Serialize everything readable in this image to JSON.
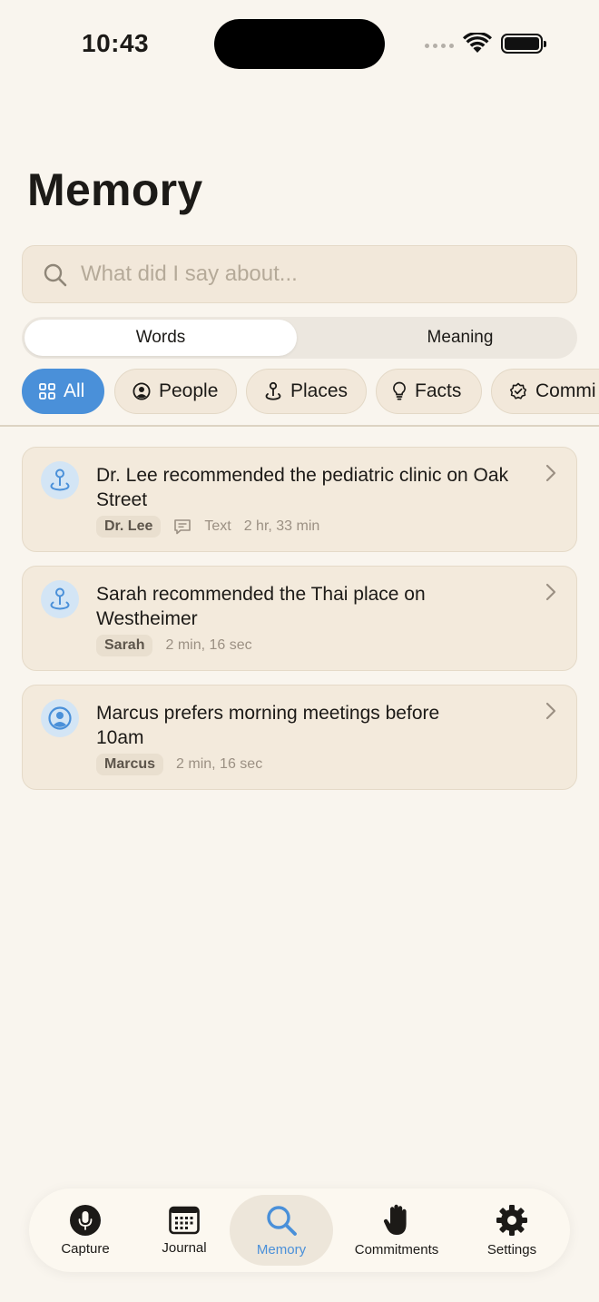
{
  "status_bar": {
    "time": "10:43"
  },
  "header": {
    "title": "Memory"
  },
  "search": {
    "placeholder": "What did I say about..."
  },
  "segmented": {
    "options": [
      "Words",
      "Meaning"
    ],
    "selected": "Words"
  },
  "filters": {
    "items": [
      {
        "label": "All",
        "icon": "grid-icon",
        "active": true
      },
      {
        "label": "People",
        "icon": "person-circle-icon",
        "active": false
      },
      {
        "label": "Places",
        "icon": "location-pin-icon",
        "active": false
      },
      {
        "label": "Facts",
        "icon": "lightbulb-icon",
        "active": false
      },
      {
        "label": "Commi",
        "icon": "checkmark-seal-icon",
        "active": false
      }
    ]
  },
  "memories": [
    {
      "title": "Dr. Lee recommended the pediatric clinic on Oak Street",
      "person": "Dr. Lee",
      "source": "Text",
      "time": "2 hr, 33 min",
      "icon": "location-pin-icon"
    },
    {
      "title": "Sarah recommended the Thai place on Westheimer",
      "person": "Sarah",
      "time": "2 min, 16 sec",
      "icon": "location-pin-icon"
    },
    {
      "title": "Marcus prefers morning meetings before 10am",
      "person": "Marcus",
      "time": "2 min, 16 sec",
      "icon": "person-circle-icon"
    }
  ],
  "tabbar": {
    "tabs": [
      {
        "label": "Capture",
        "icon": "microphone-icon"
      },
      {
        "label": "Journal",
        "icon": "calendar-icon"
      },
      {
        "label": "Memory",
        "icon": "magnifier-icon",
        "active": true
      },
      {
        "label": "Commitments",
        "icon": "hand-icon"
      },
      {
        "label": "Settings",
        "icon": "gear-icon"
      }
    ]
  },
  "colors": {
    "accent": "#4a90d9",
    "background": "#f9f5ee",
    "card": "#f3eadc"
  }
}
